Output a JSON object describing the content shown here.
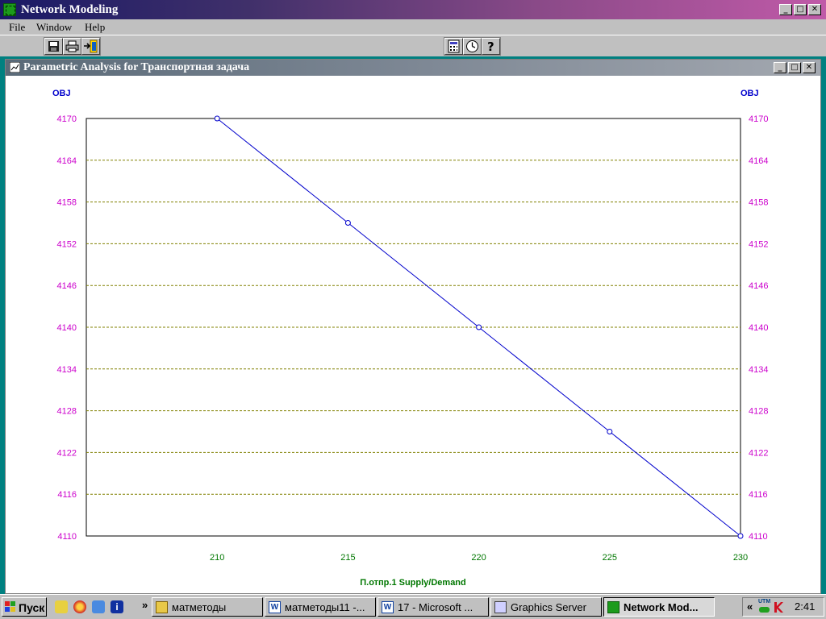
{
  "app": {
    "title": "Network Modeling"
  },
  "menu": [
    "File",
    "Window",
    "Help"
  ],
  "child": {
    "title": "Parametric Analysis for Транспортная задача"
  },
  "chart_data": {
    "type": "line",
    "x": [
      210,
      215,
      220,
      225,
      230
    ],
    "series": [
      {
        "values": [
          4170,
          4155,
          4140,
          4125,
          4110
        ],
        "color": "#0000cc"
      }
    ],
    "xlabel": "П.отпр.1 Supply/Demand",
    "ylabel_left": "OBJ",
    "ylabel_right": "OBJ",
    "xticks": [
      210,
      215,
      220,
      225,
      230
    ],
    "yticks": [
      4110,
      4116,
      4122,
      4128,
      4134,
      4140,
      4146,
      4152,
      4158,
      4164,
      4170
    ],
    "xlim": [
      205,
      230
    ],
    "ylim": [
      4110,
      4170
    ],
    "grid": true,
    "colors": {
      "ytick": "#cc00cc",
      "xtick": "#007700",
      "xlabel": "#007700",
      "ylabel": "#0000cc",
      "grid": "#808000"
    }
  },
  "taskbar": {
    "start": "Пуск",
    "chevron": "»",
    "tasks": [
      {
        "label": "матметоды",
        "icon": "folder-icon"
      },
      {
        "label": "матметоды11 -...",
        "icon": "word-icon"
      },
      {
        "label": "17 - Microsoft ...",
        "icon": "word-icon"
      },
      {
        "label": "Graphics Server",
        "icon": "graphics-server-icon"
      },
      {
        "label": "Network Mod...",
        "icon": "network-modeling-icon"
      }
    ],
    "tray_chevron": "«",
    "tray_label": "UTM",
    "clock": "2:41"
  }
}
